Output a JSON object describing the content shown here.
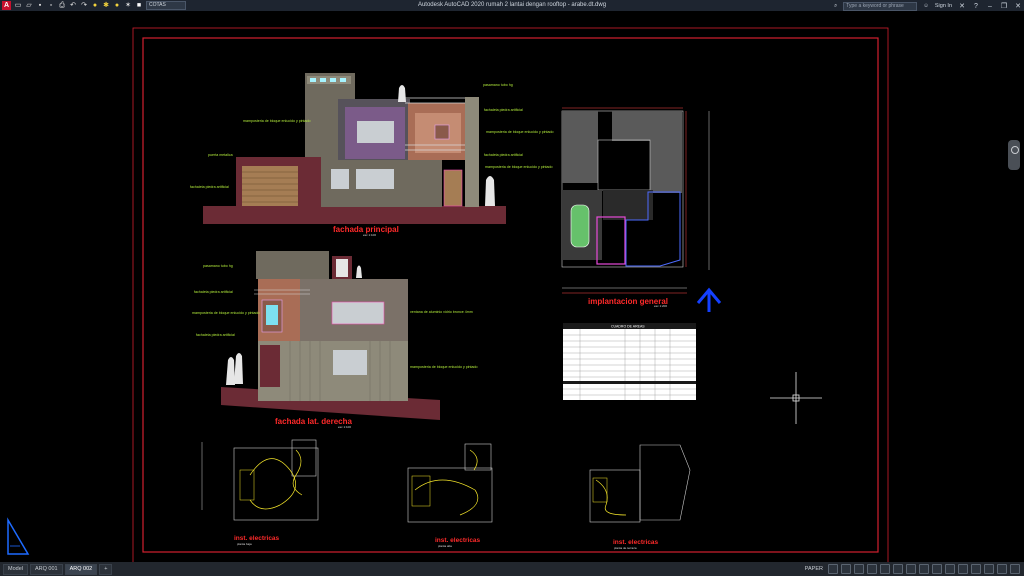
{
  "app": {
    "window_title": "Autodesk AutoCAD 2020   rumah 2 lantai dengan rooftop - arabe.dt.dwg",
    "workspace": "COTAS",
    "search_placeholder": "Type a keyword or phrase",
    "sign_in": "Sign In"
  },
  "drawing": {
    "facade_main_title": "fachada principal",
    "facade_main_scale": "esc 1:100",
    "facade_side_title": "fachada lat. derecha",
    "facade_side_scale": "esc 1:100",
    "site_plan_title": "implantacion general",
    "site_plan_scale": "esc 1:200",
    "elec_titles": [
      "inst. electricas",
      "inst. electricas",
      "inst. electricas"
    ],
    "elec_subtitles": [
      "planta baja",
      "planta alta",
      "planta de terraza"
    ],
    "area_table_title": "CUADRO DE AREAS",
    "annotations_main": [
      "pasamano tubo hg",
      "fachaleta piedra artificial",
      "mamposteria de bloque enlucido y pintado",
      "mamposteria de bloque enlucido y pintado",
      "puerta metalica",
      "fachaleta piedra artificial",
      "mamposteria de bloque enlucido y pintado",
      "fachaleta piedra artificial"
    ],
    "annotations_side": [
      "pasamano tubo hg",
      "fachaleta piedra artificial",
      "mamposteria de bloque enlucido y pintado",
      "fachaleta piedra artificial",
      "ventana de aluminio vidrio bronce 4mm",
      "mamposteria de bloque enlucido y pintado"
    ]
  },
  "status": {
    "tabs": [
      "Model",
      "ARQ 001",
      "ARQ 002"
    ],
    "active_tab": "ARQ 002",
    "paper": "PAPER"
  },
  "colors": {
    "frame_red": "#d2202f",
    "label_green": "#b6f03c",
    "title_red": "#ff2a2a",
    "wall_brown": "#6b2b35",
    "north_blue": "#1440ff"
  }
}
